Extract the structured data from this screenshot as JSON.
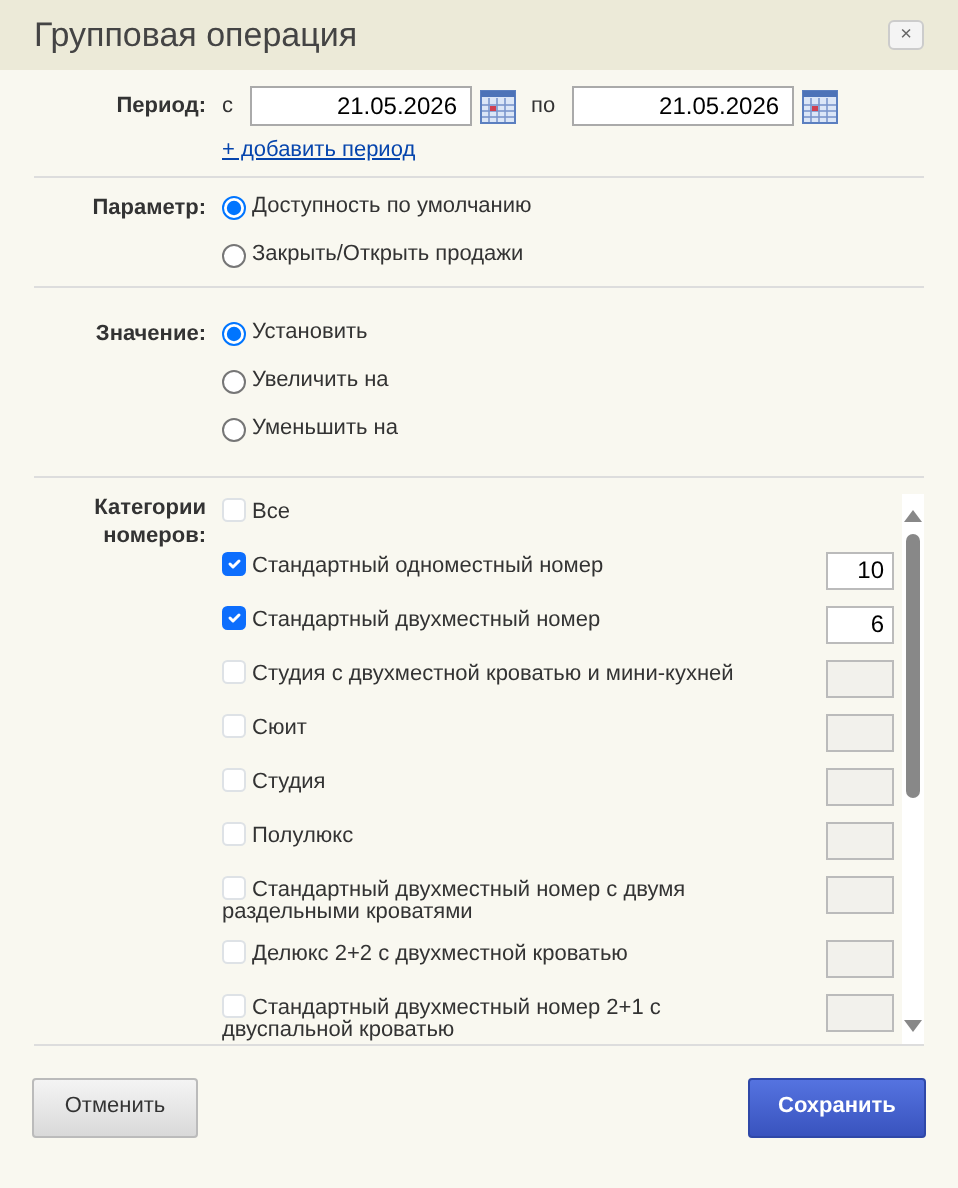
{
  "window": {
    "title": "Групповая операция",
    "close": "×"
  },
  "period": {
    "label": "Период:",
    "from_label": "с",
    "from": "21.05.2026",
    "to_label": "по",
    "to": "21.05.2026",
    "add_link": "+ добавить период"
  },
  "parameter": {
    "label": "Параметр:",
    "options": [
      {
        "label": "Доступность по умолчанию",
        "selected": true
      },
      {
        "label": "Закрыть/Открыть продажи",
        "selected": false
      }
    ]
  },
  "value": {
    "label": "Значение:",
    "options": [
      {
        "label": "Установить",
        "selected": true
      },
      {
        "label": "Увеличить на",
        "selected": false
      },
      {
        "label": "Уменьшить на",
        "selected": false
      }
    ]
  },
  "categories": {
    "label": "Категории номеров:",
    "all": {
      "label": "Все",
      "checked": false
    },
    "items": [
      {
        "label": "Стандартный одноместный номер",
        "checked": true,
        "value": "10"
      },
      {
        "label": "Стандартный двухместный номер",
        "checked": true,
        "value": "6"
      },
      {
        "label": "Студия с двухместной кроватью и мини-кухней",
        "checked": false
      },
      {
        "label": "Сюит",
        "checked": false
      },
      {
        "label": "Студия",
        "checked": false
      },
      {
        "label": "Полулюкс",
        "checked": false
      },
      {
        "label": "Стандартный двухместный номер с двумя раздельными кроватями",
        "checked": false
      },
      {
        "label": "Делюкс 2+2 с двухместной кроватью",
        "checked": false
      },
      {
        "label": "Стандартный двухместный номер 2+1 с двуспальной кроватью",
        "checked": false
      }
    ]
  },
  "buttons": {
    "cancel": "Отменить",
    "save": "Сохранить"
  }
}
